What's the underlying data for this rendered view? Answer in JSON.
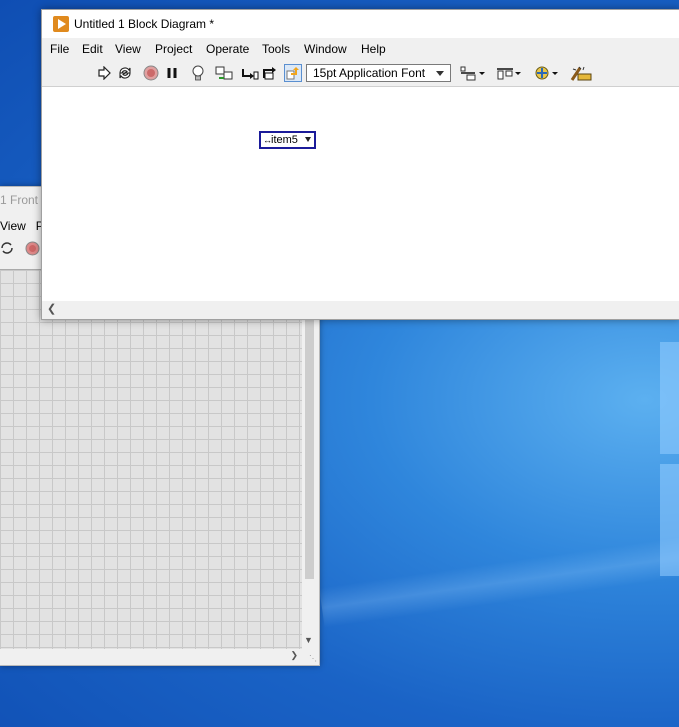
{
  "desktop": {
    "accent": "#1a63c6"
  },
  "front_panel": {
    "title": "1 Front",
    "menu": [
      "View",
      "P"
    ]
  },
  "block_diagram": {
    "title": "Untitled 1 Block Diagram *",
    "menu": [
      "File",
      "Edit",
      "View",
      "Project",
      "Operate",
      "Tools",
      "Window",
      "Help"
    ],
    "toolbar": {
      "font": "15pt Application Font",
      "buttons": [
        "run-icon",
        "run-continuously-icon",
        "abort-icon",
        "pause-icon",
        "highlight-execution-icon",
        "retain-wire-values-icon",
        "step-into-icon",
        "step-over-icon",
        "step-out-icon",
        "align-objects-icon",
        "distribute-objects-icon",
        "reorder-icon",
        "clean-up-diagram-icon"
      ]
    },
    "ring_constant": {
      "label": "item5"
    }
  }
}
